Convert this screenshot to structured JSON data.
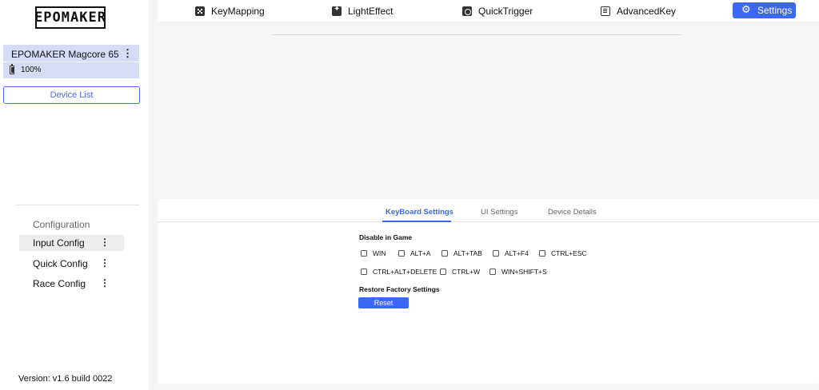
{
  "sidebar": {
    "logo": "EPOMAKER",
    "device": {
      "name": "EPOMAKER Magcore 65",
      "battery": "100%"
    },
    "device_list_label": "Device List",
    "config_heading": "Configuration",
    "config_items": [
      {
        "label": "Input Config",
        "active": true
      },
      {
        "label": "Quick Config",
        "active": false
      },
      {
        "label": "Race Config",
        "active": false
      }
    ],
    "version": "Version: v1.6 build 0022"
  },
  "topnav": {
    "items": [
      {
        "label": "KeyMapping",
        "icon": "keymapping-icon"
      },
      {
        "label": "LightEffect",
        "icon": "lighteffect-icon"
      },
      {
        "label": "QuickTrigger",
        "icon": "quicktrigger-icon"
      },
      {
        "label": "AdvancedKey",
        "icon": "advancedkey-icon"
      }
    ],
    "settings_label": "Settings"
  },
  "settings": {
    "tabs": [
      "KeyBoard Settings",
      "UI Settings",
      "Device Details"
    ],
    "active_tab": "KeyBoard Settings",
    "disable_in_game_title": "Disable in Game",
    "disable_options_row1": [
      "WIN",
      "ALT+A",
      "ALT+TAB",
      "ALT+F4",
      "CTRL+ESC"
    ],
    "disable_options_row2": [
      "CTRL+ALT+DELETE",
      "CTRL+W",
      "WIN+SHIFT+S"
    ],
    "restore_title": "Restore Factory Settings",
    "reset_label": "Reset"
  },
  "colors": {
    "accent": "#3d67f5",
    "device_card": "#d6dcf6",
    "background": "#f4f5f7"
  }
}
